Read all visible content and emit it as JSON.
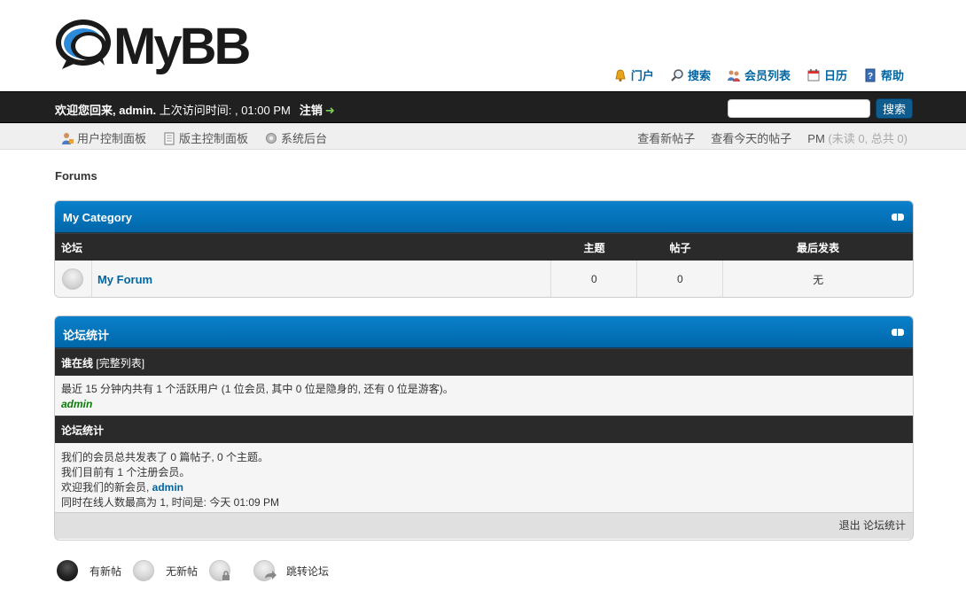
{
  "brand": {
    "logo_text": "MyBB"
  },
  "top_links": [
    {
      "label": "门户",
      "icon": "bell-icon"
    },
    {
      "label": "搜索",
      "icon": "magnifier-icon"
    },
    {
      "label": "会员列表",
      "icon": "members-icon"
    },
    {
      "label": "日历",
      "icon": "calendar-icon"
    },
    {
      "label": "帮助",
      "icon": "help-icon"
    }
  ],
  "welcome": {
    "greeting": "欢迎您回来, ",
    "username": "admin.",
    "last_visit": " 上次访问时间: , 01:00 PM",
    "logout_label": "注销",
    "logout_arrow": "➜"
  },
  "search": {
    "placeholder": "",
    "button_label": "搜索"
  },
  "panel_links": {
    "left": [
      "用户控制面板",
      "版主控制面板",
      "系统后台"
    ],
    "new_posts": "查看新帖子",
    "today_posts": "查看今天的帖子",
    "pm_label": "PM",
    "pm_counts": "(未读 0, 总共 0)"
  },
  "breadcrumb": "Forums",
  "category": {
    "title": "My Category",
    "columns": {
      "forum": "论坛",
      "threads": "主题",
      "posts": "帖子",
      "lastpost": "最后发表"
    },
    "forums": [
      {
        "name": "My Forum",
        "threads": "0",
        "posts": "0",
        "lastpost": "无"
      }
    ]
  },
  "stats": {
    "title": "论坛统计",
    "online_header": "谁在线",
    "online_full_list": "[完整列表]",
    "online_text": "最近 15 分钟内共有 1 个活跃用户 (1 位会员, 其中 0 位是隐身的, 还有 0 位是游客)。",
    "online_user": "admin",
    "stats_header": "论坛统计",
    "line1": "我们的会员总共发表了 0 篇帖子, 0 个主题。",
    "line2": "我们目前有 1 个注册会员。",
    "line3_prefix": "欢迎我们的新会员, ",
    "newest_member": "admin",
    "line4": "同时在线人数最高为 1, 时间是: 今天 01:09 PM",
    "footer_link": "退出 论坛统计"
  },
  "legend": [
    {
      "label": "有新帖",
      "icon": "forum-new-icon"
    },
    {
      "label": "无新帖",
      "icon": "forum-old-icon"
    },
    {
      "label": "",
      "icon": "forum-locked-icon"
    },
    {
      "label": "跳转论坛",
      "icon": "forum-redirect-icon"
    }
  ]
}
